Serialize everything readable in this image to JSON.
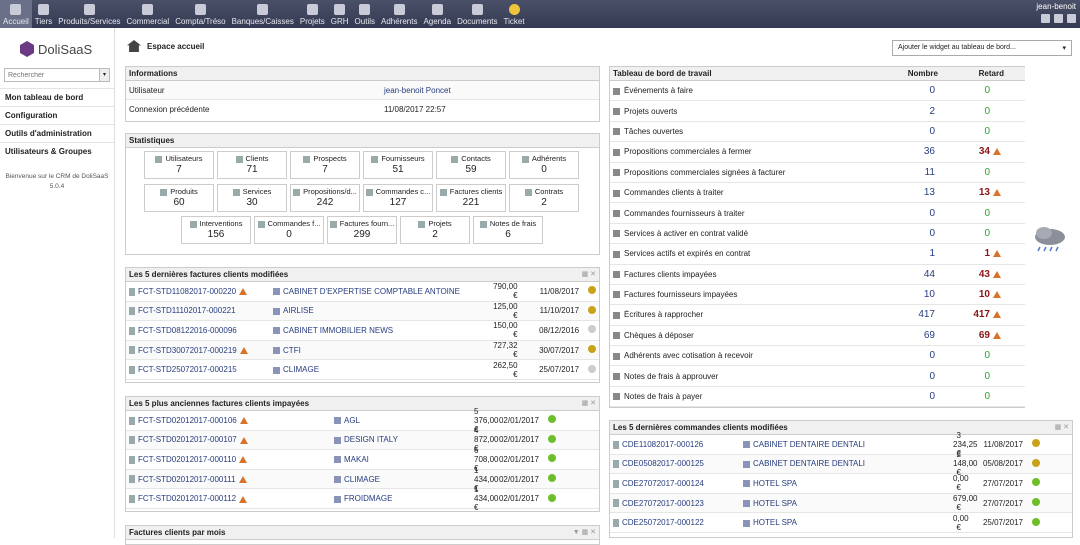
{
  "topmenu": [
    {
      "label": "Accueil",
      "icon": "home-icon",
      "active": true
    },
    {
      "label": "Tiers",
      "icon": "company-icon"
    },
    {
      "label": "Produits/Services",
      "icon": "product-icon"
    },
    {
      "label": "Commercial",
      "icon": "commercial-icon"
    },
    {
      "label": "Compta/Tréso",
      "icon": "accounting-icon"
    },
    {
      "label": "Banques/Caisses",
      "icon": "bank-icon"
    },
    {
      "label": "Projets",
      "icon": "project-icon"
    },
    {
      "label": "GRH",
      "icon": "hrm-icon"
    },
    {
      "label": "Outils",
      "icon": "tools-icon"
    },
    {
      "label": "Adhérents",
      "icon": "members-icon"
    },
    {
      "label": "Agenda",
      "icon": "agenda-icon"
    },
    {
      "label": "Documents",
      "icon": "documents-icon"
    },
    {
      "label": "Ticket",
      "icon": "ticket-icon"
    }
  ],
  "user": {
    "name": "jean-benoit"
  },
  "sidebar": {
    "logo": "DoliSaaS",
    "search_placeholder": "Rechercher",
    "items": [
      "Mon tableau de bord",
      "Configuration",
      "Outils d'administration",
      "Utilisateurs & Groupes"
    ],
    "welcome_line1": "Bienvenue sur le CRM de DoliSaaS",
    "welcome_line2": "5.0.4"
  },
  "page": {
    "title": "Espace accueil",
    "widget_select": "Ajouter le widget au tableau de bord..."
  },
  "info": {
    "title": "Informations",
    "user_label": "Utilisateur",
    "user_value": "jean-benoit Poncet",
    "conn_label": "Connexion précédente",
    "conn_value": "11/08/2017 22:57"
  },
  "stats": {
    "title": "Statistiques",
    "items": [
      {
        "label": "Utilisateurs",
        "value": "7"
      },
      {
        "label": "Clients",
        "value": "71"
      },
      {
        "label": "Prospects",
        "value": "7"
      },
      {
        "label": "Fournisseurs",
        "value": "51"
      },
      {
        "label": "Contacts",
        "value": "59"
      },
      {
        "label": "Adhérents",
        "value": "0"
      },
      {
        "label": "Produits",
        "value": "60"
      },
      {
        "label": "Services",
        "value": "30"
      },
      {
        "label": "Propositions/d...",
        "value": "242"
      },
      {
        "label": "Commandes c...",
        "value": "127"
      },
      {
        "label": "Factures clients",
        "value": "221"
      },
      {
        "label": "Contrats",
        "value": "2"
      },
      {
        "label": "Interventions",
        "value": "156"
      },
      {
        "label": "Commandes f...",
        "value": "0"
      },
      {
        "label": "Factures fourn...",
        "value": "299"
      },
      {
        "label": "Projets",
        "value": "2"
      },
      {
        "label": "Notes de frais",
        "value": "6"
      }
    ]
  },
  "last_invoices": {
    "title": "Les 5 dernières factures clients modifiées",
    "rows": [
      {
        "ref": "FCT-STD11082017-000220",
        "warn": true,
        "client": "CABINET D'EXPERTISE COMPTABLE ANTOINE",
        "amount": "790,00 €",
        "date": "11/08/2017",
        "status": "#c9a21a"
      },
      {
        "ref": "FCT-STD11102017-000221",
        "warn": false,
        "client": "AIRLISE",
        "amount": "125,00 €",
        "date": "11/10/2017",
        "status": "#c9a21a"
      },
      {
        "ref": "FCT-STD08122016-000096",
        "warn": false,
        "client": "CABINET IMMOBILIER NEWS",
        "amount": "150,00 €",
        "date": "08/12/2016",
        "status": "#cccccc"
      },
      {
        "ref": "FCT-STD30072017-000219",
        "warn": true,
        "client": "CTFI",
        "amount": "727,32 €",
        "date": "30/07/2017",
        "status": "#c9a21a"
      },
      {
        "ref": "FCT-STD25072017-000215",
        "warn": false,
        "client": "CLIMAGE",
        "amount": "262,50 €",
        "date": "25/07/2017",
        "status": "#cccccc"
      }
    ]
  },
  "old_unpaid": {
    "title": "Les 5 plus anciennes factures clients impayées",
    "rows": [
      {
        "ref": "FCT-STD02012017-000106",
        "client": "AGL",
        "amount": "5 376,00 €",
        "date": "02/01/2017",
        "status": "#6cbf2a"
      },
      {
        "ref": "FCT-STD02012017-000107",
        "client": "DESIGN ITALY",
        "amount": "4 872,00 €",
        "date": "02/01/2017",
        "status": "#6cbf2a"
      },
      {
        "ref": "FCT-STD02012017-000110",
        "client": "MAKAI",
        "amount": "6 708,00 €",
        "date": "02/01/2017",
        "status": "#6cbf2a"
      },
      {
        "ref": "FCT-STD02012017-000111",
        "client": "CLIMAGE",
        "amount": "1 434,00 €",
        "date": "02/01/2017",
        "status": "#6cbf2a"
      },
      {
        "ref": "FCT-STD02012017-000112",
        "client": "FROIDMAGE",
        "amount": "1 434,00 €",
        "date": "02/01/2017",
        "status": "#6cbf2a"
      }
    ]
  },
  "invoices_month": {
    "title": "Factures clients par mois"
  },
  "dashboard": {
    "title": "Tableau de bord de travail",
    "col_num": "Nombre",
    "col_late": "Retard",
    "rows": [
      {
        "label": "Événements à faire",
        "num": "0",
        "late": "0",
        "alert": false
      },
      {
        "label": "Projets ouverts",
        "num": "2",
        "late": "0",
        "alert": false
      },
      {
        "label": "Tâches ouvertes",
        "num": "0",
        "late": "0",
        "alert": false
      },
      {
        "label": "Propositions commerciales à fermer",
        "num": "36",
        "late": "34",
        "alert": true
      },
      {
        "label": "Propositions commerciales signées à facturer",
        "num": "11",
        "late": "0",
        "alert": false
      },
      {
        "label": "Commandes clients à traiter",
        "num": "13",
        "late": "13",
        "alert": true
      },
      {
        "label": "Commandes fournisseurs à traiter",
        "num": "0",
        "late": "0",
        "alert": false
      },
      {
        "label": "Services à activer en contrat validé",
        "num": "0",
        "late": "0",
        "alert": false
      },
      {
        "label": "Services actifs et expirés en contrat",
        "num": "1",
        "late": "1",
        "alert": true
      },
      {
        "label": "Factures clients impayées",
        "num": "44",
        "late": "43",
        "alert": true
      },
      {
        "label": "Factures fournisseurs impayées",
        "num": "10",
        "late": "10",
        "alert": true
      },
      {
        "label": "Écritures à rapprocher",
        "num": "417",
        "late": "417",
        "alert": true
      },
      {
        "label": "Chèques à déposer",
        "num": "69",
        "late": "69",
        "alert": true
      },
      {
        "label": "Adhérents avec cotisation à recevoir",
        "num": "0",
        "late": "0",
        "alert": false
      },
      {
        "label": "Notes de frais à approuver",
        "num": "0",
        "late": "0",
        "alert": false
      },
      {
        "label": "Notes de frais à payer",
        "num": "0",
        "late": "0",
        "alert": false
      }
    ]
  },
  "last_orders": {
    "title": "Les 5 dernières commandes clients modifiées",
    "rows": [
      {
        "ref": "CDE11082017-000126",
        "client": "CABINET DENTAIRE DENTALI",
        "amount": "3 234,25 €",
        "date": "11/08/2017",
        "status": "#c9a21a"
      },
      {
        "ref": "CDE05082017-000125",
        "client": "CABINET DENTAIRE DENTALI",
        "amount": "2 148,00 €",
        "date": "05/08/2017",
        "status": "#c9a21a"
      },
      {
        "ref": "CDE27072017-000124",
        "client": "HOTEL SPA",
        "amount": "0,00 €",
        "date": "27/07/2017",
        "status": "#6cbf2a"
      },
      {
        "ref": "CDE27072017-000123",
        "client": "HOTEL SPA",
        "amount": "679,00 €",
        "date": "27/07/2017",
        "status": "#6cbf2a"
      },
      {
        "ref": "CDE25072017-000122",
        "client": "HOTEL SPA",
        "amount": "0,00 €",
        "date": "25/07/2017",
        "status": "#6cbf2a"
      }
    ]
  }
}
